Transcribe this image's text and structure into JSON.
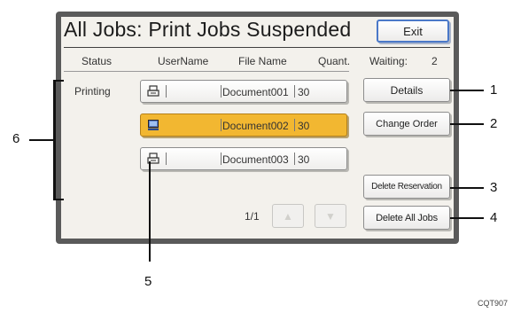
{
  "screen": {
    "title": "All Jobs: Print Jobs Suspended",
    "exit_label": "Exit"
  },
  "columns": {
    "status": "Status",
    "user": "UserName",
    "file": "File Name",
    "quant": "Quant.",
    "waiting_label": "Waiting:",
    "waiting_count": "2"
  },
  "status_text": "Printing",
  "jobs": [
    {
      "icon": "printer-icon",
      "user": "",
      "file": "Document001",
      "quantity": "30",
      "selected": false
    },
    {
      "icon": "computer-icon",
      "user": "",
      "file": "Document002",
      "quantity": "30",
      "selected": true
    },
    {
      "icon": "printer-icon",
      "user": "",
      "file": "Document003",
      "quantity": "30",
      "selected": false
    }
  ],
  "buttons": {
    "details": "Details",
    "change_order": "Change Order",
    "delete_reservation": "Delete Reservation",
    "delete_all": "Delete All Jobs"
  },
  "pager": {
    "text": "1/1",
    "up": "▲",
    "down": "▼"
  },
  "callouts": {
    "c1": "1",
    "c2": "2",
    "c3": "3",
    "c4": "4",
    "c5": "5",
    "c6": "6"
  },
  "footer_code": "CQT907"
}
